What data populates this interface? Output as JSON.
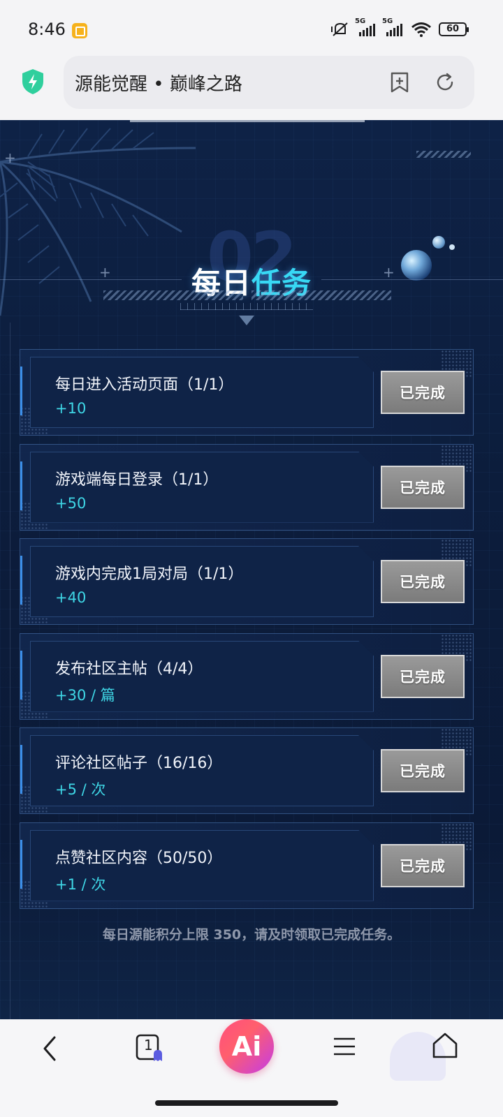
{
  "status_bar": {
    "time": "8:46",
    "signal1_label": "5G",
    "signal2_label": "5G",
    "battery": "60"
  },
  "browser": {
    "url_title": "源能觉醒 • 巅峰之路"
  },
  "section": {
    "number": "02",
    "title_white": "每日",
    "title_cyan": "任务"
  },
  "tasks": [
    {
      "name": "每日进入活动页面（1/1）",
      "reward": "+10",
      "status": "已完成"
    },
    {
      "name": "游戏端每日登录（1/1）",
      "reward": "+50",
      "status": "已完成"
    },
    {
      "name": "游戏内完成1局对局（1/1）",
      "reward": "+40",
      "status": "已完成"
    },
    {
      "name": "发布社区主帖（4/4）",
      "reward": "+30 / 篇",
      "status": "已完成"
    },
    {
      "name": "评论社区帖子（16/16）",
      "reward": "+5 / 次",
      "status": "已完成"
    },
    {
      "name": "点赞社区内容（50/50）",
      "reward": "+1 / 次",
      "status": "已完成"
    }
  ],
  "footer_note": "每日源能积分上限 350，请及时领取已完成任务。",
  "bottom_nav": {
    "tab_count": "1",
    "ai_label": "Ai"
  },
  "colors": {
    "accent_cyan": "#38d9f5",
    "reward_cyan": "#3fd7e6",
    "completed_button": "#8a8a8a",
    "page_background": "#0c1d3c"
  }
}
